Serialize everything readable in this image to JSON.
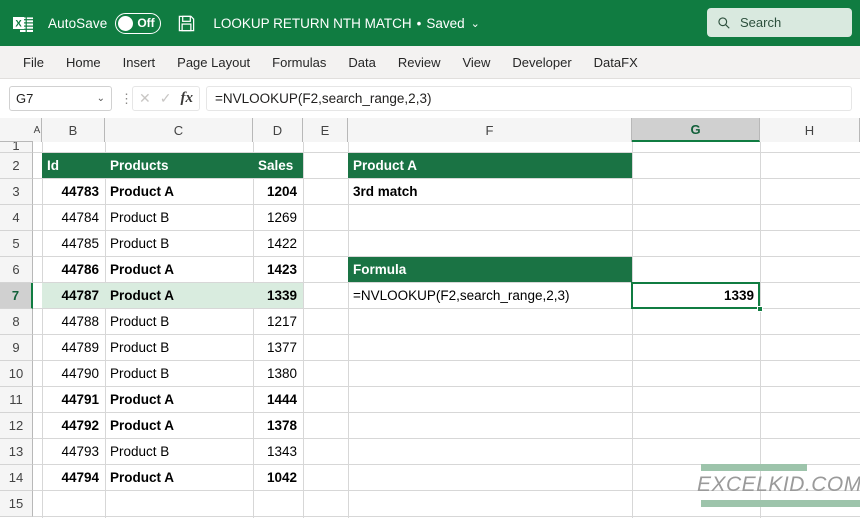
{
  "titlebar": {
    "app_icon": "excel-logo-icon",
    "autosave_label": "AutoSave",
    "autosave_state": "Off",
    "save_icon": "save-floppy-icon",
    "document_title": "LOOKUP RETURN NTH MATCH",
    "separator": "•",
    "saved_status": "Saved",
    "chevron": "⌄",
    "brand_color": "#107c41"
  },
  "search": {
    "icon": "search-icon",
    "placeholder": "Search",
    "value": "Search"
  },
  "ribbon": {
    "tabs": [
      {
        "label": "File"
      },
      {
        "label": "Home"
      },
      {
        "label": "Insert"
      },
      {
        "label": "Page Layout"
      },
      {
        "label": "Formulas"
      },
      {
        "label": "Data"
      },
      {
        "label": "Review"
      },
      {
        "label": "View"
      },
      {
        "label": "Developer"
      },
      {
        "label": "DataFX"
      }
    ]
  },
  "formula_bar": {
    "name_box_value": "G7",
    "name_box_chevron": "⌄",
    "cancel_icon": "close-icon",
    "enter_icon": "check-icon",
    "function_icon": "fx",
    "formula": "=NVLOOKUP(F2,search_range,2,3)"
  },
  "grid": {
    "columns": [
      "A",
      "B",
      "C",
      "D",
      "E",
      "F",
      "G",
      "H"
    ],
    "selected_column": "G",
    "rows": [
      "1",
      "2",
      "3",
      "4",
      "5",
      "6",
      "7",
      "8",
      "9",
      "10",
      "11",
      "12",
      "13",
      "14",
      "15"
    ],
    "selected_row": "7",
    "selected_cell": "G7",
    "table": {
      "headers": {
        "id": "Id",
        "products": "Products",
        "sales": "Sales"
      },
      "rows": [
        {
          "row": "3",
          "id": "44783",
          "product": "Product A",
          "sales": "1204",
          "bold": true
        },
        {
          "row": "4",
          "id": "44784",
          "product": "Product B",
          "sales": "1269",
          "bold": false
        },
        {
          "row": "5",
          "id": "44785",
          "product": "Product B",
          "sales": "1422",
          "bold": false
        },
        {
          "row": "6",
          "id": "44786",
          "product": "Product A",
          "sales": "1423",
          "bold": true
        },
        {
          "row": "7",
          "id": "44787",
          "product": "Product A",
          "sales": "1339",
          "bold": true
        },
        {
          "row": "8",
          "id": "44788",
          "product": "Product B",
          "sales": "1217",
          "bold": false
        },
        {
          "row": "9",
          "id": "44789",
          "product": "Product B",
          "sales": "1377",
          "bold": false
        },
        {
          "row": "10",
          "id": "44790",
          "product": "Product B",
          "sales": "1380",
          "bold": false
        },
        {
          "row": "11",
          "id": "44791",
          "product": "Product A",
          "sales": "1444",
          "bold": true
        },
        {
          "row": "12",
          "id": "44792",
          "product": "Product A",
          "sales": "1378",
          "bold": true
        },
        {
          "row": "13",
          "id": "44793",
          "product": "Product B",
          "sales": "1343",
          "bold": false
        },
        {
          "row": "14",
          "id": "44794",
          "product": "Product A",
          "sales": "1042",
          "bold": true
        }
      ]
    },
    "panel": {
      "lookup_header": "Product A",
      "lookup_note": "3rd match",
      "formula_header": "Formula",
      "formula_text": "=NVLOOKUP(F2,search_range,2,3)",
      "result_value": "1339"
    },
    "header_fill": "#1a7344",
    "selection_color": "#107c41",
    "row_highlight": "#d9ecdf"
  },
  "watermark": {
    "text": "EXCELKID.COM",
    "bar_color": "#9dc4ab"
  }
}
